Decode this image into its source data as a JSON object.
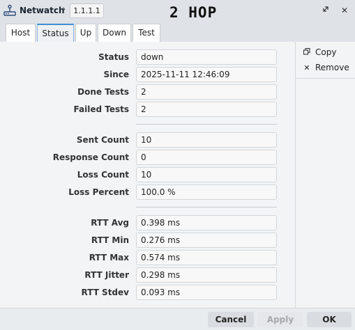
{
  "window": {
    "title": "Netwatch",
    "address": "1.1.1.1",
    "overlay_note": "2 HOP",
    "title_icon": "netwatch-icon",
    "restore_icon": "restore-icon",
    "close_icon": "close-icon"
  },
  "tabs": [
    {
      "label": "Host",
      "active": false
    },
    {
      "label": "Status",
      "active": true
    },
    {
      "label": "Up",
      "active": false
    },
    {
      "label": "Down",
      "active": false
    },
    {
      "label": "Test",
      "active": false
    }
  ],
  "status": {
    "status": {
      "label": "Status",
      "value": "down"
    },
    "since": {
      "label": "Since",
      "value": "2025-11-11 12:46:09"
    },
    "done_tests": {
      "label": "Done Tests",
      "value": "2"
    },
    "failed_tests": {
      "label": "Failed Tests",
      "value": "2"
    },
    "sent_count": {
      "label": "Sent Count",
      "value": "10"
    },
    "response_count": {
      "label": "Response Count",
      "value": "0"
    },
    "loss_count": {
      "label": "Loss Count",
      "value": "10"
    },
    "loss_percent": {
      "label": "Loss Percent",
      "value": "100.0 %"
    },
    "rtt_avg": {
      "label": "RTT Avg",
      "value": "0.398 ms"
    },
    "rtt_min": {
      "label": "RTT Min",
      "value": "0.276 ms"
    },
    "rtt_max": {
      "label": "RTT Max",
      "value": "0.574 ms"
    },
    "rtt_jitter": {
      "label": "RTT Jitter",
      "value": "0.298 ms"
    },
    "rtt_stdev": {
      "label": "RTT Stdev",
      "value": "0.093 ms"
    }
  },
  "side_actions": {
    "copy": {
      "label": "Copy",
      "icon": "copy-icon"
    },
    "remove": {
      "label": "Remove",
      "icon": "remove-icon"
    }
  },
  "footer": {
    "cancel": "Cancel",
    "apply": "Apply",
    "ok": "OK"
  },
  "colors": {
    "titlebar_bg": "#dfe3e8",
    "panel_bg": "#f2f4f6",
    "active_tab_accent": "#3d8fd6"
  }
}
